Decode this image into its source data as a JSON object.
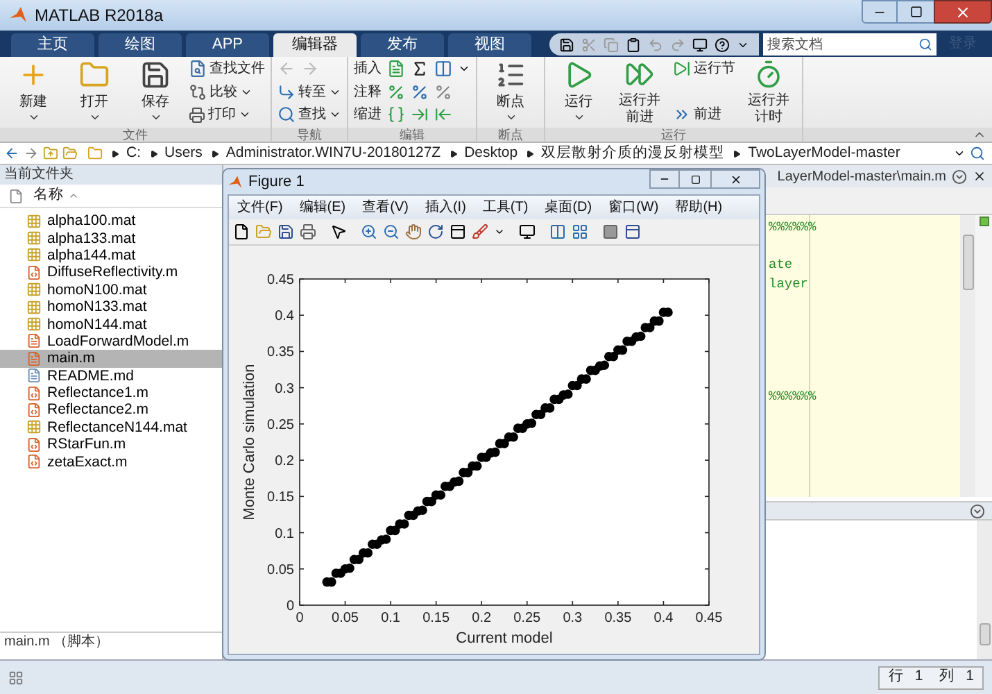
{
  "window": {
    "title": "MATLAB R2018a"
  },
  "tabs": [
    {
      "label": "主页",
      "selected": false
    },
    {
      "label": "绘图",
      "selected": false
    },
    {
      "label": "APP",
      "selected": false
    },
    {
      "label": "编辑器",
      "selected": true
    },
    {
      "label": "发布",
      "selected": false
    },
    {
      "label": "视图",
      "selected": false
    }
  ],
  "search": {
    "placeholder": "搜索文档"
  },
  "login": "登录",
  "ribbon": {
    "groups": [
      {
        "label": "文件",
        "items": [
          {
            "kind": "large",
            "label": "新建",
            "caret": true
          },
          {
            "kind": "large",
            "label": "打开",
            "caret": true
          },
          {
            "kind": "large",
            "label": "保存",
            "caret": true
          },
          {
            "kind": "stack",
            "rows": [
              {
                "kind": "text",
                "label": "查找文件",
                "caret": false
              },
              {
                "kind": "text",
                "label": "比较",
                "caret": true
              },
              {
                "kind": "text",
                "label": "打印",
                "caret": true
              }
            ]
          }
        ]
      },
      {
        "label": "导航",
        "items": [
          {
            "kind": "stack",
            "rows": [
              {
                "kind": "arrows",
                "disabled": true
              },
              {
                "kind": "text",
                "label": "转至",
                "caret": true
              },
              {
                "kind": "text",
                "label": "查找",
                "caret": true
              }
            ]
          }
        ]
      },
      {
        "label": "编辑",
        "items": [
          {
            "kind": "stack",
            "rows": [
              {
                "kind": "text",
                "label": "插入",
                "caret": true
              },
              {
                "kind": "text",
                "label": "注释",
                "caret": false
              },
              {
                "kind": "text",
                "label": "缩进",
                "caret": false
              }
            ]
          }
        ]
      },
      {
        "label": "断点",
        "items": [
          {
            "kind": "large",
            "label": "断点",
            "caret": true
          }
        ]
      },
      {
        "label": "运行",
        "items": [
          {
            "kind": "large",
            "label": "运行",
            "caret": true
          },
          {
            "kind": "large",
            "label": "运行并前进",
            "caret": false
          },
          {
            "kind": "stack",
            "rows": [
              {
                "kind": "text",
                "label": "运行节",
                "caret": false
              },
              {
                "kind": "text",
                "label": "前进",
                "caret": false
              }
            ]
          },
          {
            "kind": "large",
            "label": "运行并计时",
            "caret": false
          }
        ]
      }
    ]
  },
  "address_bar": {
    "segments": [
      "C:",
      "Users",
      "Administrator.WIN7U-20180127Z",
      "Desktop",
      "双层散射介质的漫反射模型",
      "TwoLayerModel-master"
    ]
  },
  "current_folder": {
    "title": "当前文件夹",
    "column": "名称",
    "files": [
      {
        "name": "alpha100.mat",
        "kind": "mat",
        "selected": false
      },
      {
        "name": "alpha133.mat",
        "kind": "mat",
        "selected": false
      },
      {
        "name": "alpha144.mat",
        "kind": "mat",
        "selected": false
      },
      {
        "name": "DiffuseReflectivity.m",
        "kind": "function",
        "selected": false
      },
      {
        "name": "homoN100.mat",
        "kind": "mat",
        "selected": false
      },
      {
        "name": "homoN133.mat",
        "kind": "mat",
        "selected": false
      },
      {
        "name": "homoN144.mat",
        "kind": "mat",
        "selected": false
      },
      {
        "name": "LoadForwardModel.m",
        "kind": "script",
        "selected": false
      },
      {
        "name": "main.m",
        "kind": "script",
        "selected": true
      },
      {
        "name": "README.md",
        "kind": "text",
        "selected": false
      },
      {
        "name": "Reflectance1.m",
        "kind": "function",
        "selected": false
      },
      {
        "name": "Reflectance2.m",
        "kind": "function",
        "selected": false
      },
      {
        "name": "ReflectanceN144.mat",
        "kind": "mat",
        "selected": false
      },
      {
        "name": "RStarFun.m",
        "kind": "function",
        "selected": false
      },
      {
        "name": "zetaExact.m",
        "kind": "function",
        "selected": false
      }
    ],
    "details": "main.m （脚本）"
  },
  "editor": {
    "tab_title": "LayerModel-master\\main.m",
    "code_lines": [
      {
        "text": "%%%%%%"
      },
      {
        "text": "ate"
      },
      {
        "text": "layer"
      },
      {
        "text": "%%%%%%"
      }
    ]
  },
  "status_bar": [
    {
      "label": "行",
      "value": "1"
    },
    {
      "label": "列",
      "value": "1"
    }
  ],
  "figure": {
    "title": "Figure 1",
    "menu": [
      "文件(F)",
      "编辑(E)",
      "查看(V)",
      "插入(I)",
      "工具(T)",
      "桌面(D)",
      "窗口(W)",
      "帮助(H)"
    ],
    "chart_data": {
      "type": "scatter",
      "xlabel": "Current model",
      "ylabel": "Monte Carlo simulation",
      "x": [
        0.03,
        0.035,
        0.04,
        0.045,
        0.05,
        0.055,
        0.06,
        0.065,
        0.07,
        0.075,
        0.08,
        0.085,
        0.09,
        0.095,
        0.1,
        0.105,
        0.11,
        0.115,
        0.12,
        0.125,
        0.13,
        0.135,
        0.14,
        0.145,
        0.15,
        0.155,
        0.16,
        0.165,
        0.17,
        0.175,
        0.18,
        0.185,
        0.19,
        0.195,
        0.2,
        0.205,
        0.21,
        0.215,
        0.22,
        0.225,
        0.23,
        0.235,
        0.24,
        0.245,
        0.25,
        0.255,
        0.26,
        0.265,
        0.27,
        0.275,
        0.28,
        0.285,
        0.29,
        0.295,
        0.3,
        0.305,
        0.31,
        0.315,
        0.32,
        0.325,
        0.33,
        0.335,
        0.34,
        0.345,
        0.35,
        0.355,
        0.36,
        0.365,
        0.37,
        0.375,
        0.38,
        0.385,
        0.39,
        0.395,
        0.4,
        0.405
      ],
      "series": [
        {
          "color": "#000000",
          "values": [
            0.032,
            0.032,
            0.044,
            0.044,
            0.05,
            0.051,
            0.063,
            0.063,
            0.072,
            0.072,
            0.084,
            0.084,
            0.09,
            0.091,
            0.103,
            0.103,
            0.112,
            0.112,
            0.124,
            0.124,
            0.13,
            0.131,
            0.143,
            0.143,
            0.152,
            0.152,
            0.164,
            0.164,
            0.17,
            0.171,
            0.183,
            0.183,
            0.192,
            0.192,
            0.204,
            0.204,
            0.21,
            0.211,
            0.223,
            0.223,
            0.232,
            0.232,
            0.244,
            0.244,
            0.25,
            0.251,
            0.263,
            0.263,
            0.272,
            0.272,
            0.284,
            0.284,
            0.29,
            0.291,
            0.303,
            0.303,
            0.312,
            0.312,
            0.324,
            0.324,
            0.33,
            0.331,
            0.343,
            0.343,
            0.352,
            0.352,
            0.364,
            0.364,
            0.37,
            0.371,
            0.383,
            0.383,
            0.392,
            0.392,
            0.404,
            0.404
          ]
        }
      ],
      "xlim": [
        0,
        0.45
      ],
      "ylim": [
        0,
        0.45
      ],
      "xticks": [
        0,
        0.05,
        0.1,
        0.15,
        0.2,
        0.25,
        0.3,
        0.35,
        0.4,
        0.45
      ],
      "yticks": [
        0,
        0.05,
        0.1,
        0.15,
        0.2,
        0.25,
        0.3,
        0.35,
        0.4,
        0.45
      ]
    }
  }
}
